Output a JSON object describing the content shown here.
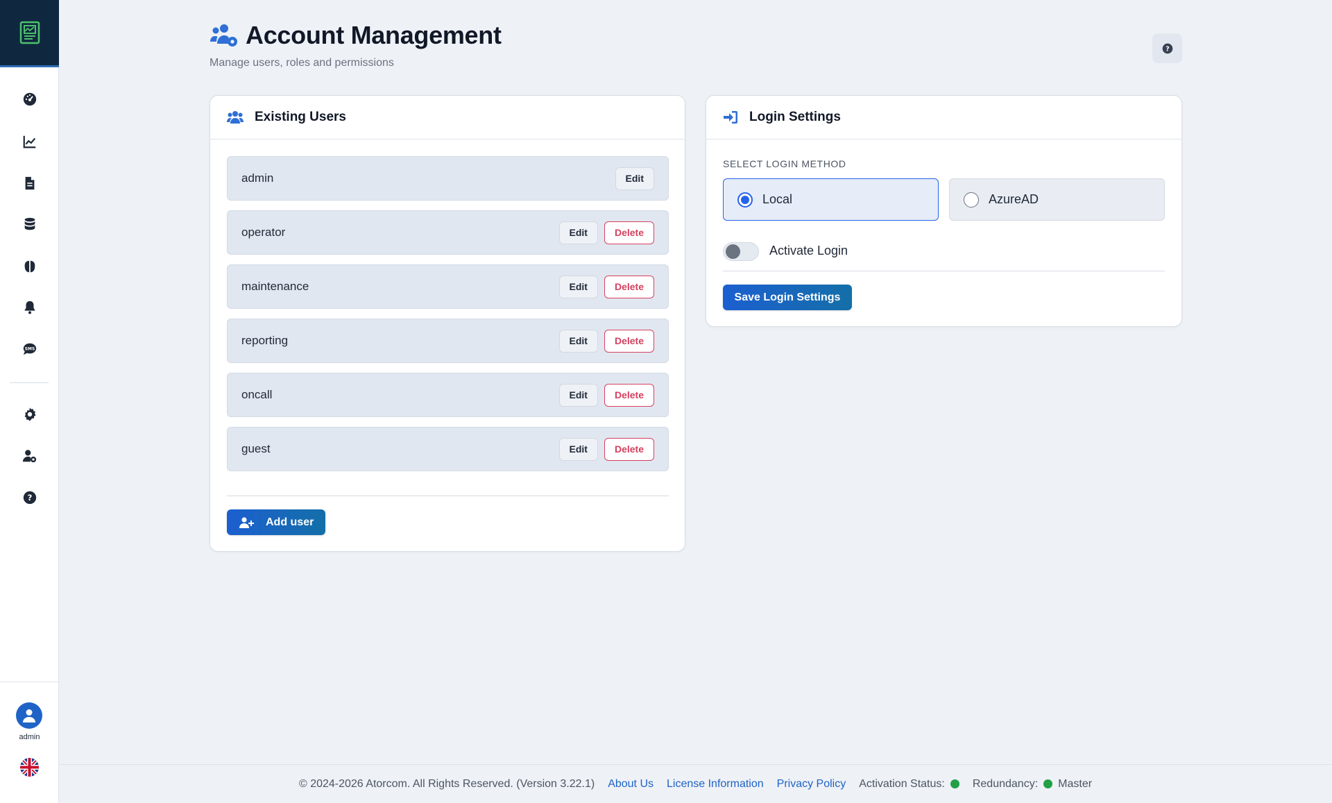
{
  "sidebar": {
    "logo_icon": "report-logo-icon",
    "items": [
      {
        "name": "dashboard-icon"
      },
      {
        "name": "chart-line-icon"
      },
      {
        "name": "file-icon"
      },
      {
        "name": "database-icon"
      },
      {
        "name": "brain-icon"
      },
      {
        "name": "bell-icon"
      },
      {
        "name": "sms-icon"
      },
      {
        "name": "gear-icon"
      },
      {
        "name": "user-cog-icon"
      },
      {
        "name": "question-icon"
      }
    ],
    "user_label": "admin",
    "language": "en-GB"
  },
  "header": {
    "title": "Account Management",
    "subtitle": "Manage users, roles and permissions",
    "icon": "users-cog-icon"
  },
  "users_card": {
    "title": "Existing Users",
    "edit_label": "Edit",
    "delete_label": "Delete",
    "add_user_label": "Add user",
    "users": [
      {
        "name": "admin",
        "deletable": false
      },
      {
        "name": "operator",
        "deletable": true
      },
      {
        "name": "maintenance",
        "deletable": true
      },
      {
        "name": "reporting",
        "deletable": true
      },
      {
        "name": "oncall",
        "deletable": true
      },
      {
        "name": "guest",
        "deletable": true
      }
    ]
  },
  "login_card": {
    "title": "Login Settings",
    "section_label": "SELECT LOGIN METHOD",
    "methods": [
      {
        "label": "Local",
        "selected": true
      },
      {
        "label": "AzureAD",
        "selected": false
      }
    ],
    "activate_label": "Activate Login",
    "activate_on": false,
    "save_label": "Save Login Settings"
  },
  "footer": {
    "copyright": "© 2024-2026 Atorcom. All Rights Reserved. (Version 3.22.1)",
    "about": "About Us",
    "license": "License Information",
    "privacy": "Privacy Policy",
    "activation_label": "Activation Status:",
    "redundancy_label": "Redundancy:",
    "redundancy_value": "Master",
    "status_color": "#22a045"
  },
  "colors": {
    "accent": "#1f63c6",
    "danger": "#d6405e",
    "sidebar_dark": "#0f2840"
  }
}
